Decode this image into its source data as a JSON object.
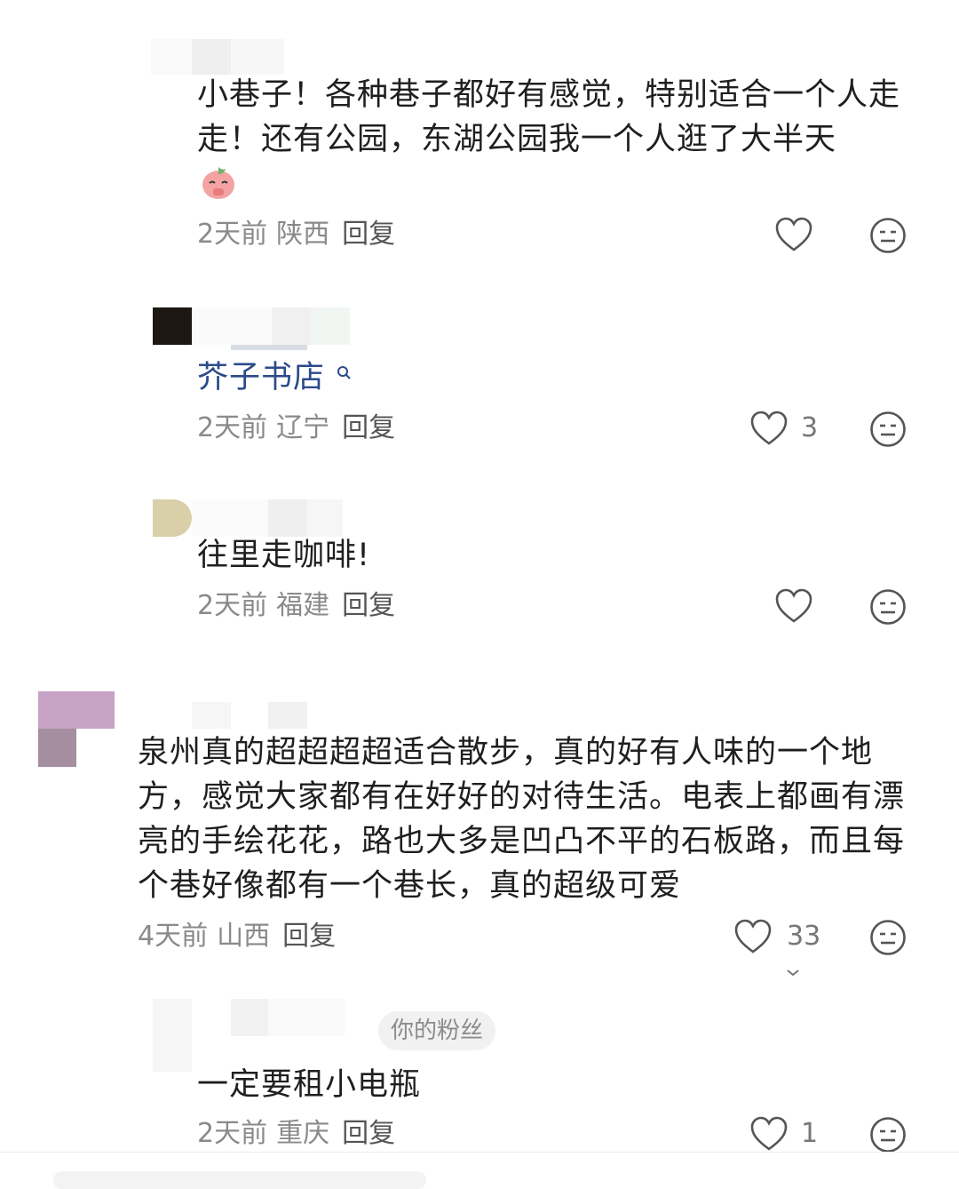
{
  "comments": [
    {
      "text": "小巷子！各种巷子都好有感觉，特别适合一个人走走！还有公园，东湖公园我一个人逛了大半天",
      "emoji_name": "praying-peach-emoji",
      "time": "2天前",
      "location": "陕西",
      "reply_label": "回复",
      "likes": ""
    },
    {
      "text": "芥子书店",
      "link_icon": "search-icon",
      "time": "2天前",
      "location": "辽宁",
      "reply_label": "回复",
      "likes": "3"
    },
    {
      "text": "往里走咖啡!",
      "time": "2天前",
      "location": "福建",
      "reply_label": "回复",
      "likes": ""
    },
    {
      "text": "泉州真的超超超超适合散步，真的好有人味的一个地方，感觉大家都有在好好的对待生活。电表上都画有漂亮的手绘花花，路也大多是凹凸不平的石板路，而且每个巷好像都有一个巷长，真的超级可爱",
      "time": "4天前",
      "location": "山西",
      "reply_label": "回复",
      "likes": "33"
    },
    {
      "badge": "你的粉丝",
      "text": "一定要租小电瓶",
      "time": "2天前",
      "location": "重庆",
      "reply_label": "回复",
      "likes": "1"
    }
  ],
  "colors": {
    "text": "#1f1f1f",
    "meta": "#8a8a8a",
    "link": "#2c4b8a",
    "icon": "#555555"
  }
}
